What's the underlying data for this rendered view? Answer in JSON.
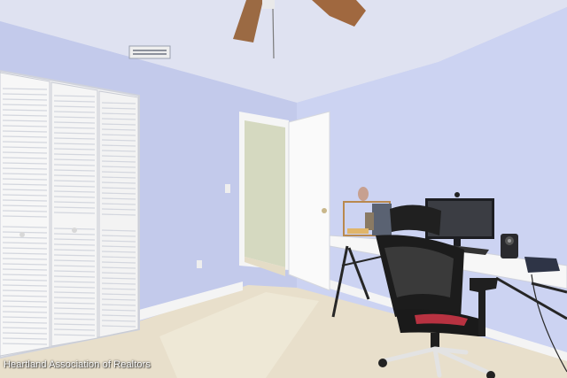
{
  "watermark": {
    "text": "Heartland Association of Realtors"
  },
  "colors": {
    "wall": "#c5cdef",
    "ceiling": "#dcdff0",
    "floor": "#e6ddc8",
    "closet_door": "#f7f7f7",
    "door": "#f8f8f8",
    "baseboard": "#f2f2f2"
  }
}
